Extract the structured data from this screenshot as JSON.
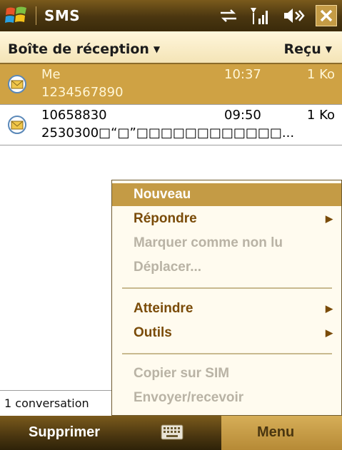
{
  "titlebar": {
    "app_title": "SMS",
    "icons": [
      "windows-start-icon",
      "sync-arrows-icon",
      "signal-icon",
      "speaker-icon",
      "close-icon"
    ],
    "close_glyph": "✕"
  },
  "inbox": {
    "folder_label": "Boîte de réception",
    "sort_label": "Reçu",
    "caret": "▼"
  },
  "messages": [
    {
      "sender": "Me",
      "time": "10:37",
      "size": "1 Ko",
      "preview": "1234567890",
      "selected": true
    },
    {
      "sender": "10658830",
      "time": "09:50",
      "size": "1 Ko",
      "preview": "2530300□“□”□□□□□□□□□□□□...",
      "selected": false
    }
  ],
  "status": {
    "conversation_count": "1 conversation"
  },
  "menu": {
    "items": [
      {
        "label": "Nouveau",
        "state": "active"
      },
      {
        "label": "Répondre",
        "state": "enabled",
        "submenu": "▶"
      },
      {
        "label": "Marquer comme non lu",
        "state": "disabled"
      },
      {
        "label": "Déplacer...",
        "state": "disabled"
      },
      {
        "label": "Atteindre",
        "state": "enabled",
        "submenu": "▶"
      },
      {
        "label": "Outils",
        "state": "enabled",
        "submenu": "▶"
      },
      {
        "label": "Copier sur SIM",
        "state": "disabled"
      },
      {
        "label": "Envoyer/recevoir",
        "state": "disabled"
      }
    ]
  },
  "softkeys": {
    "left": "Supprimer",
    "right": "Menu",
    "center_icon": "keyboard-icon"
  },
  "colors": {
    "accent": "#c49b45",
    "bar_dark": "#4a3610",
    "menu_text": "#7a4b08",
    "disabled_text": "#b9b3a5"
  }
}
